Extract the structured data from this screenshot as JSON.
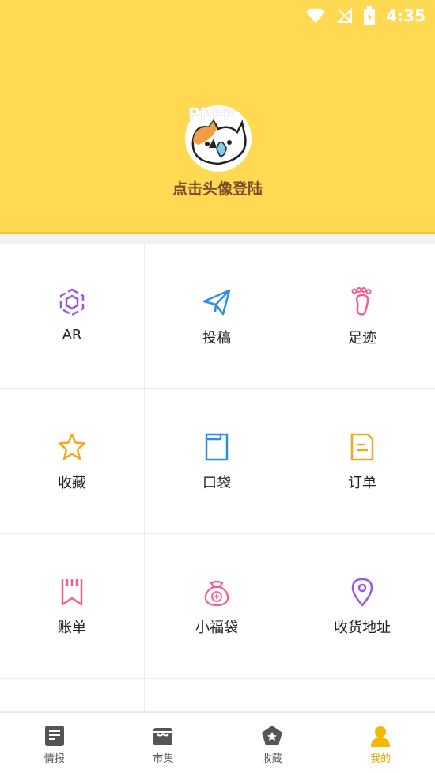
{
  "status_bar": {
    "time": "4:35",
    "wifi_icon": "wifi-icon",
    "signal_icon": "no-signal-icon",
    "battery_icon": "battery-charging-icon"
  },
  "header": {
    "login_text": "点击头像登陆",
    "avatar_icon": "cat-avatar-icon",
    "bg_color": "#FFD952"
  },
  "menu": {
    "items": [
      {
        "label": "AR",
        "icon": "ar-cube-icon",
        "color": "#9B59E0"
      },
      {
        "label": "投稿",
        "icon": "paper-plane-icon",
        "color": "#2B8FE6"
      },
      {
        "label": "足迹",
        "icon": "footprint-icon",
        "color": "#F05F8F"
      },
      {
        "label": "收藏",
        "icon": "star-icon",
        "color": "#F5A623"
      },
      {
        "label": "口袋",
        "icon": "pocket-icon",
        "color": "#2B8FE6"
      },
      {
        "label": "订单",
        "icon": "order-doc-icon",
        "color": "#F5A623"
      },
      {
        "label": "账单",
        "icon": "bill-icon",
        "color": "#F05F8F"
      },
      {
        "label": "小福袋",
        "icon": "lucky-bag-icon",
        "color": "#F05F8F"
      },
      {
        "label": "收货地址",
        "icon": "location-pin-icon",
        "color": "#9B59E0"
      }
    ]
  },
  "tabbar": {
    "tabs": [
      {
        "label": "情报",
        "icon": "news-icon",
        "active": false
      },
      {
        "label": "市集",
        "icon": "market-icon",
        "active": false
      },
      {
        "label": "收藏",
        "icon": "favorite-icon",
        "active": false
      },
      {
        "label": "我的",
        "icon": "profile-icon",
        "active": true
      }
    ],
    "active_color": "#E6A800"
  }
}
